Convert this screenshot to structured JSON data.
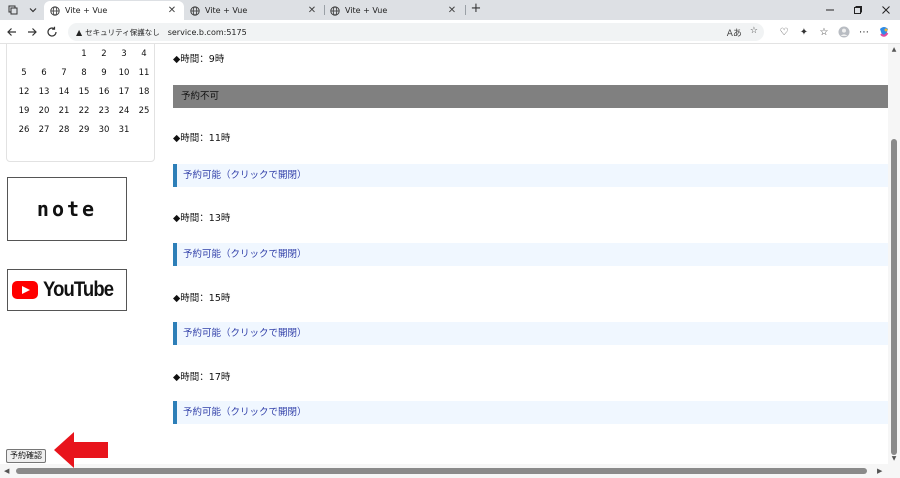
{
  "browser": {
    "tabs": [
      {
        "title": "Vite + Vue",
        "active": true
      },
      {
        "title": "Vite + Vue",
        "active": false
      },
      {
        "title": "Vite + Vue",
        "active": false
      }
    ],
    "security_label": "セキュリティ保護なし",
    "url": "service.b.com:5175"
  },
  "calendar": {
    "weeks": [
      [
        "",
        "",
        "",
        "1",
        "2",
        "3",
        "4"
      ],
      [
        "5",
        "6",
        "7",
        "8",
        "9",
        "10",
        "11"
      ],
      [
        "12",
        "13",
        "14",
        "15",
        "16",
        "17",
        "18"
      ],
      [
        "19",
        "20",
        "21",
        "22",
        "23",
        "24",
        "25"
      ],
      [
        "26",
        "27",
        "28",
        "29",
        "30",
        "31",
        ""
      ]
    ]
  },
  "banners": {
    "note_text": "note",
    "youtube_text": "YouTube"
  },
  "schedule": {
    "slot_9": "◆時間：9時",
    "unavailable": "予約不可",
    "slot_11": "◆時間：11時",
    "avail_11": "予約可能（クリックで開閉）",
    "slot_13": "◆時間：13時",
    "avail_13": "予約可能（クリックで開閉）",
    "slot_15": "◆時間：15時",
    "avail_15": "予約可能（クリックで開閉）",
    "slot_17": "◆時間：17時",
    "avail_17": "予約可能（クリックで開閉）"
  },
  "confirm_button": "予約確認",
  "colors": {
    "unavailable_bg": "#808080",
    "available_bg": "#f0f7ff",
    "available_border": "#2d7fb8",
    "available_text": "#2f3ea8",
    "annotation_arrow": "#e8141c"
  }
}
